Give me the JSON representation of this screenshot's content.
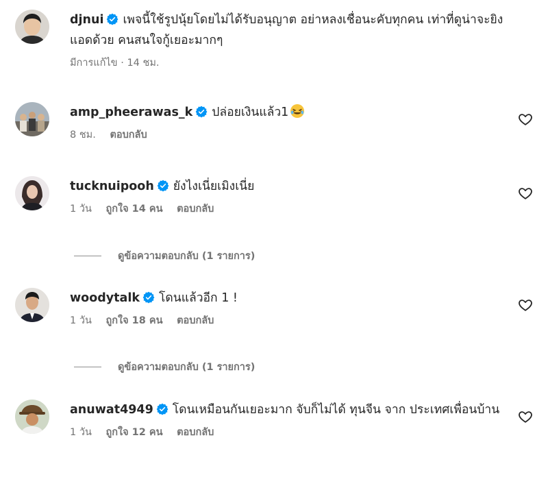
{
  "comments": [
    {
      "username": "djnui",
      "text": "เพจนี้ใช้รูปนุ้ยโดยไม่ได้รับอนุญาต อย่าหลงเชื่อนะคับทุกคน เท่าที่ดูน่าจะยิงแอดด้วย คนสนใจกู้เยอะมากๆ",
      "edited": "มีการแก้ไข",
      "time": "14 ชม."
    },
    {
      "username": "amp_pheerawas_k",
      "text": "ปล่อยเงินแล้ว1",
      "emoji": "😂",
      "time": "8 ชม.",
      "reply": "ตอบกลับ"
    },
    {
      "username": "tucknuipooh",
      "text": "ยังไงเนี่ยเมิงเนี่ย",
      "time": "1 วัน",
      "likes": "ถูกใจ 14 คน",
      "reply": "ตอบกลับ",
      "view_replies": "ดูข้อความตอบกลับ (1 รายการ)"
    },
    {
      "username": "woodytalk",
      "text": "โดนแล้วอีก 1 !",
      "time": "1 วัน",
      "likes": "ถูกใจ 18 คน",
      "reply": "ตอบกลับ",
      "view_replies": "ดูข้อความตอบกลับ (1 รายการ)"
    },
    {
      "username": "anuwat4949",
      "text": "โดนเหมือนกันเยอะมาก จับก็ไม่ได้ ทุนจีน จาก ประเทศเพื่อนบ้าน",
      "time": "1 วัน",
      "likes": "ถูกใจ 12 คน",
      "reply": "ตอบกลับ"
    }
  ],
  "colors": {
    "verified": "#0095f6",
    "meta": "#737373",
    "text": "#262626"
  },
  "icons": {
    "verified": "verified-badge-icon",
    "like": "heart-outline-icon"
  }
}
